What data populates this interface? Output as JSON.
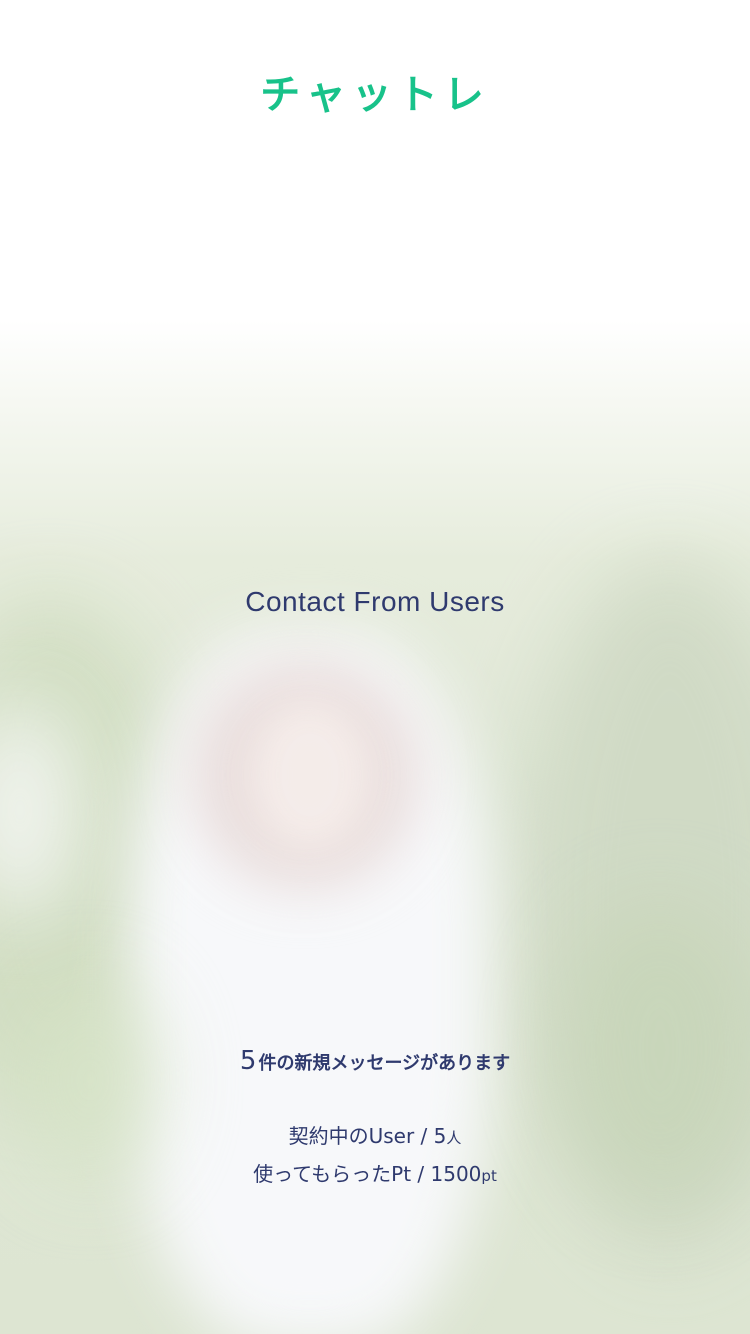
{
  "app": {
    "logo_text": "チャットレ",
    "brand_color": "#18c28a",
    "text_color": "#2f3a6e"
  },
  "main": {
    "title": "Contact From Users",
    "new_messages": {
      "count": "5",
      "text": "件の新規メッセージがあります"
    },
    "contracted_users": {
      "label": "契約中のUser / 5",
      "unit": "人"
    },
    "points_used": {
      "label": "使ってもらったPt / 1500",
      "unit": "pt"
    }
  }
}
